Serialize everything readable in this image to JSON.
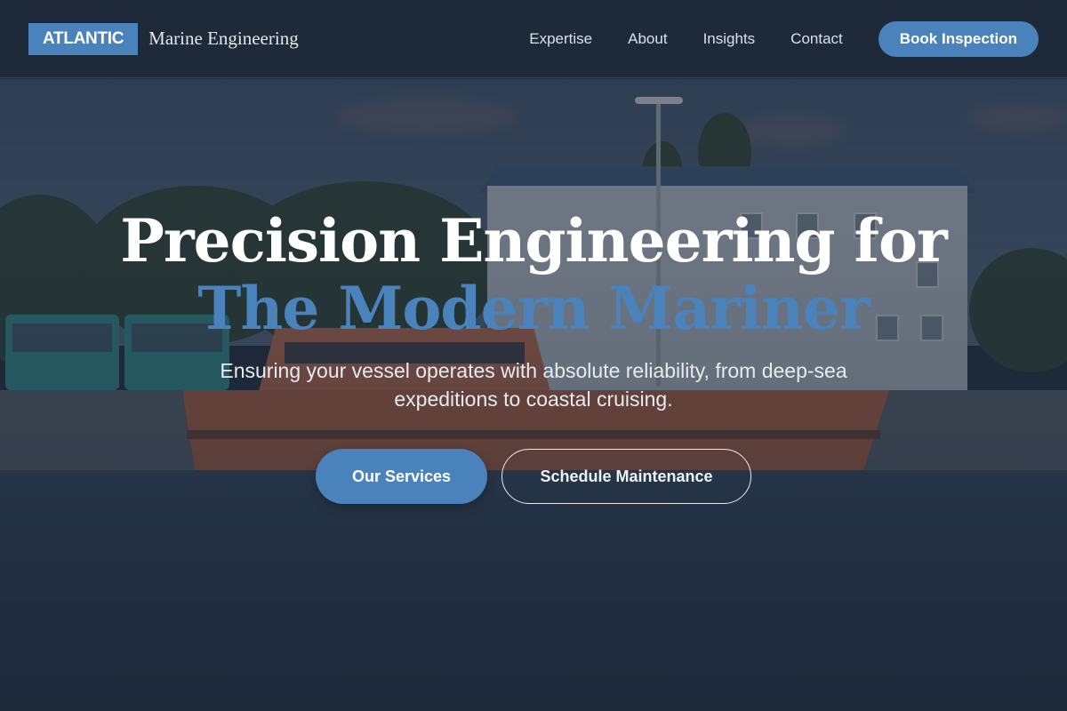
{
  "brand": {
    "badge": "ATLANTIC",
    "name": "Marine Engineering"
  },
  "nav": {
    "links": [
      "Expertise",
      "About",
      "Insights",
      "Contact"
    ],
    "cta": "Book Inspection"
  },
  "hero": {
    "title_line1": "Precision Engineering for",
    "title_line2": "The Modern Mariner",
    "subtitle": "Ensuring your vessel operates with absolute reliability, from deep-sea expeditions to coastal cruising.",
    "primary_button": "Our Services",
    "secondary_button": "Schedule Maintenance",
    "background_image": "harbor-pilot-boat-photo"
  },
  "colors": {
    "accent": "#4a82bb",
    "header_bg": "#1e2a3a",
    "text_light": "#ffffff"
  }
}
